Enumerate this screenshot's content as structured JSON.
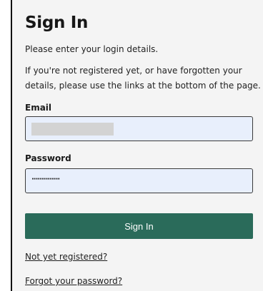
{
  "form": {
    "title": "Sign In",
    "subtitle": "Please enter your login details.",
    "info": "If you're not registered yet, or have forgotten your details, please use the links at the bottom of the page.",
    "email_label": "Email",
    "password_label": "Password",
    "password_mask": "··············",
    "submit_label": "Sign In",
    "register_link": "Not yet registered?",
    "forgot_link": "Forgot your password?"
  },
  "colors": {
    "button_bg": "#2a6b5a",
    "input_bg": "#e8effc",
    "panel_bg": "#f4f4f4"
  }
}
